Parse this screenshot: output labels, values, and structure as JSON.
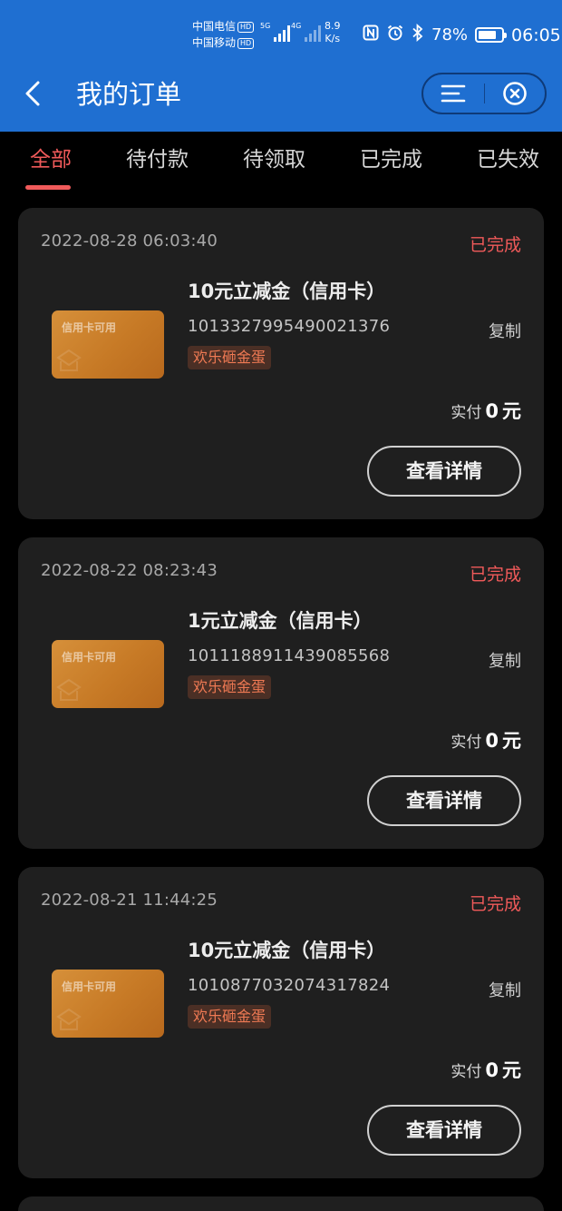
{
  "status_bar": {
    "carrier_1": "中国电信",
    "carrier_2": "中国移动",
    "hd_label": "HD",
    "net_1": "5G",
    "net_2": "4G",
    "speed_value": "8.9",
    "speed_unit": "K/s",
    "battery_pct": "78%",
    "battery_level": 0.78,
    "time": "06:05"
  },
  "header": {
    "title": "我的订单"
  },
  "tabs": [
    {
      "label": "全部",
      "active": true
    },
    {
      "label": "待付款",
      "active": false
    },
    {
      "label": "待领取",
      "active": false
    },
    {
      "label": "已完成",
      "active": false
    },
    {
      "label": "已失效",
      "active": false
    }
  ],
  "orders": [
    {
      "date": "2022-08-28 06:03:40",
      "status": "已完成",
      "thumb_label": "信用卡可用",
      "name": "10元立减金（信用卡）",
      "order_no": "1013327995490021376",
      "copy_label": "复制",
      "tag": "欢乐砸金蛋",
      "paid_prefix": "实付",
      "paid_amount": "0",
      "paid_unit": "元",
      "detail_label": "查看详情"
    },
    {
      "date": "2022-08-22 08:23:43",
      "status": "已完成",
      "thumb_label": "信用卡可用",
      "name": "1元立减金（信用卡）",
      "order_no": "1011188911439085568",
      "copy_label": "复制",
      "tag": "欢乐砸金蛋",
      "paid_prefix": "实付",
      "paid_amount": "0",
      "paid_unit": "元",
      "detail_label": "查看详情"
    },
    {
      "date": "2022-08-21 11:44:25",
      "status": "已完成",
      "thumb_label": "信用卡可用",
      "name": "10元立减金（信用卡）",
      "order_no": "1010877032074317824",
      "copy_label": "复制",
      "tag": "欢乐砸金蛋",
      "paid_prefix": "实付",
      "paid_amount": "0",
      "paid_unit": "元",
      "detail_label": "查看详情"
    }
  ],
  "colors": {
    "header_bg": "#1f6fd1",
    "accent_red": "#f05a5a",
    "card_bg": "#1f1f1f",
    "thumb_orange": "#c77a26",
    "tag_text": "#f07a54"
  }
}
